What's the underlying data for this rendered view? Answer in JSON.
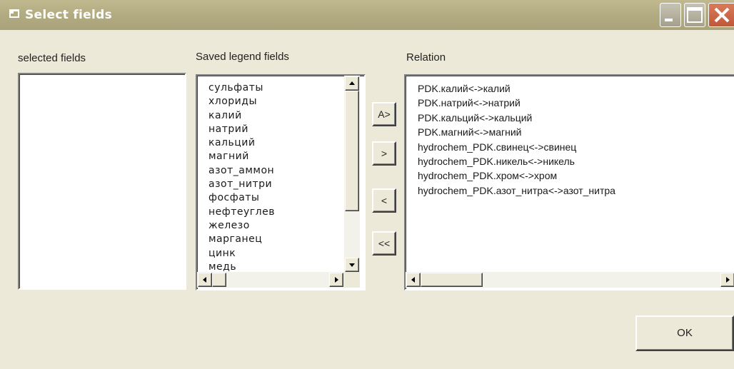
{
  "window": {
    "title": "Select fields",
    "controls": {
      "minimize_icon": "minimize-icon",
      "maximize_icon": "maximize-icon",
      "close_icon": "close-icon"
    }
  },
  "panels": {
    "selected_label": "selected fields",
    "saved_label": "Saved legend fields",
    "relation_label": "Relation"
  },
  "selected_fields": [],
  "saved_legend_fields": [
    "сульфаты",
    "хлориды",
    "калий",
    "натрий",
    "кальций",
    "магний",
    "азот_аммон",
    "азот_нитри",
    "фосфаты",
    "нефтеуглев",
    "железо",
    "марганец",
    "цинк",
    "медь"
  ],
  "relations": [
    "PDK.калий<->калий",
    "PDK.натрий<->натрий",
    "PDK.кальций<->кальций",
    "PDK.магний<->магний",
    "hydrochem_PDK.свинец<->свинец",
    "hydrochem_PDK.никель<->никель",
    "hydrochem_PDK.хром<->хром",
    "hydrochem_PDK.азот_нитра<->азот_нитра"
  ],
  "buttons": {
    "add_all": "A>",
    "add": ">",
    "remove": "<",
    "remove_all": "<<",
    "ok": "OK"
  },
  "colors": {
    "window_bg": "#ece9d8",
    "titlebar": "#b2ab82",
    "close_button": "#c0573a"
  }
}
